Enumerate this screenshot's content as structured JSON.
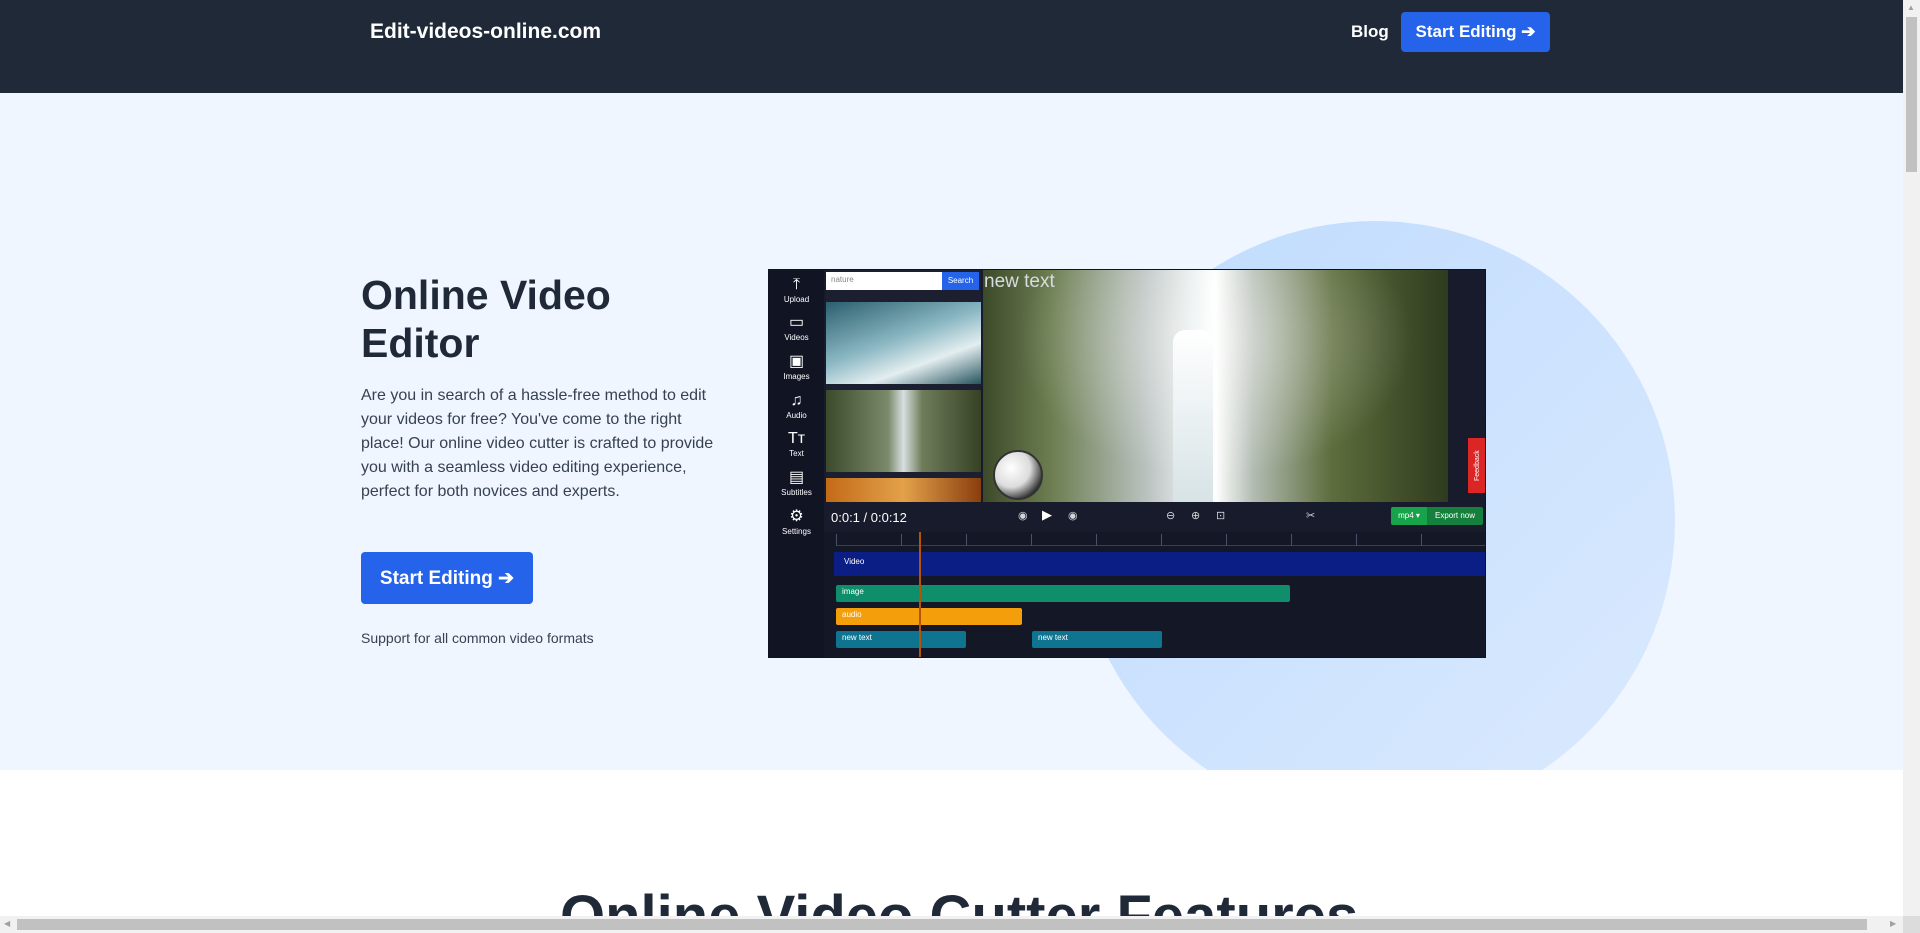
{
  "header": {
    "brand": "Edit-videos-online.com",
    "blog": "Blog",
    "cta": "Start Editing ➔"
  },
  "hero": {
    "title": "Online Video Editor",
    "description": "Are you in search of a hassle-free method to edit your videos for free? You've come to the right place! Our online video cutter is crafted to provide you with a seamless video editing experience, perfect for both novices and experts.",
    "cta": "Start Editing ➔",
    "note": "Support for all common video formats"
  },
  "editor": {
    "sidebar": [
      {
        "icon": "upload-icon",
        "glyph": "⤒",
        "label": "Upload"
      },
      {
        "icon": "video-icon",
        "glyph": "▭",
        "label": "Videos"
      },
      {
        "icon": "image-icon",
        "glyph": "▣",
        "label": "Images"
      },
      {
        "icon": "music-icon",
        "glyph": "♫",
        "label": "Audio"
      },
      {
        "icon": "text-icon",
        "glyph": "Tт",
        "label": "Text"
      },
      {
        "icon": "subtitles-icon",
        "glyph": "▤",
        "label": "Subtitles"
      },
      {
        "icon": "gear-icon",
        "glyph": "⚙",
        "label": "Settings"
      }
    ],
    "search_value": "nature",
    "search_button": "Search",
    "overlay_text": "new text",
    "feedback": "Feedback",
    "time": "0:0:1 / 0:0:12",
    "format": "mp4 ▾",
    "export": "Export now",
    "tracks": {
      "video": "Video",
      "image": "image",
      "audio": "audio",
      "text1": "new text",
      "text2": "new text"
    }
  },
  "features": {
    "title": "Online Video Cutter Features"
  },
  "colors": {
    "header_bg": "#1f2937",
    "accent": "#2563eb",
    "hero_bg": "#eff6ff"
  }
}
